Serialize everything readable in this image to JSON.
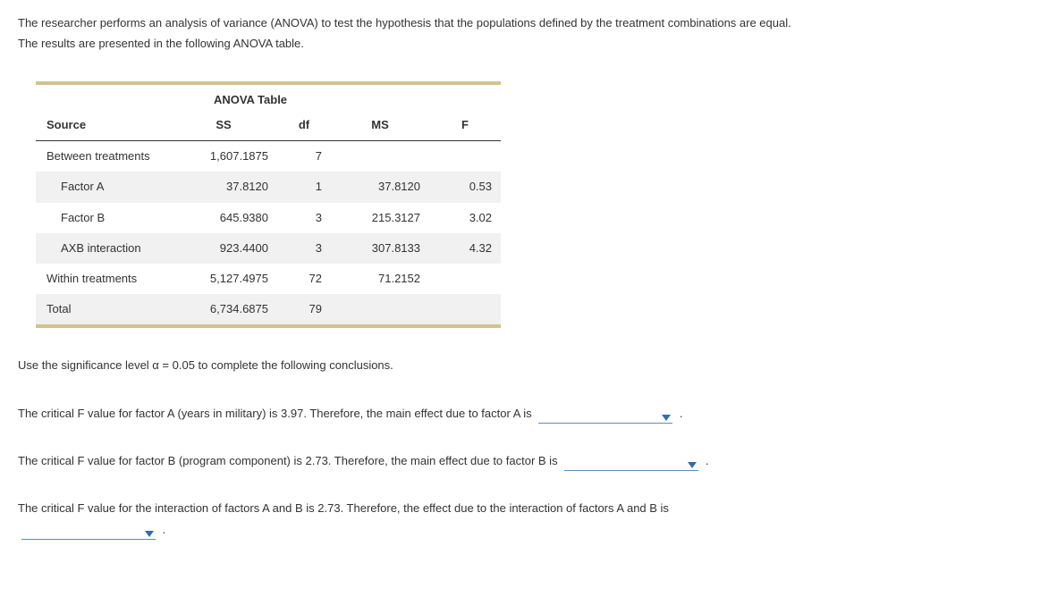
{
  "intro_line1": "The researcher performs an analysis of variance (ANOVA) to test the hypothesis that the populations defined by the treatment combinations are equal.",
  "intro_line2": "The results are presented in the following ANOVA table.",
  "table": {
    "title": "ANOVA Table",
    "headers": {
      "source": "Source",
      "ss": "SS",
      "df": "df",
      "ms": "MS",
      "f": "F"
    },
    "rows": [
      {
        "source": "Between treatments",
        "ss": "1,607.1875",
        "df": "7",
        "ms": "",
        "f": "",
        "indent": false
      },
      {
        "source": "Factor A",
        "ss": "37.8120",
        "df": "1",
        "ms": "37.8120",
        "f": "0.53",
        "indent": true
      },
      {
        "source": "Factor B",
        "ss": "645.9380",
        "df": "3",
        "ms": "215.3127",
        "f": "3.02",
        "indent": true
      },
      {
        "source": "AXB interaction",
        "ss": "923.4400",
        "df": "3",
        "ms": "307.8133",
        "f": "4.32",
        "indent": true
      },
      {
        "source": "Within treatments",
        "ss": "5,127.4975",
        "df": "72",
        "ms": "71.2152",
        "f": "",
        "indent": false
      },
      {
        "source": "Total",
        "ss": "6,734.6875",
        "df": "79",
        "ms": "",
        "f": "",
        "indent": false
      }
    ]
  },
  "q_instruction": "Use the significance level α = 0.05 to complete the following conclusions.",
  "q1_pre": "The critical F value for factor A (years in military) is 3.97. Therefore, the main effect due to factor A is ",
  "q1_post": " .",
  "q2_pre": "The critical F value for factor B (program component) is 2.73. Therefore, the main effect due to factor B is ",
  "q2_post": " .",
  "q3_pre": "The critical F value for the interaction of factors A and B is 2.73. Therefore, the effect due to the interaction of factors A and B is",
  "q3_post": " .",
  "chart_data": {
    "type": "table",
    "title": "ANOVA Table",
    "columns": [
      "Source",
      "SS",
      "df",
      "MS",
      "F"
    ],
    "rows": [
      [
        "Between treatments",
        1607.1875,
        7,
        null,
        null
      ],
      [
        "Factor A",
        37.812,
        1,
        37.812,
        0.53
      ],
      [
        "Factor B",
        645.938,
        3,
        215.3127,
        3.02
      ],
      [
        "AXB interaction",
        923.44,
        3,
        307.8133,
        4.32
      ],
      [
        "Within treatments",
        5127.4975,
        72,
        71.2152,
        null
      ],
      [
        "Total",
        6734.6875,
        79,
        null,
        null
      ]
    ]
  }
}
